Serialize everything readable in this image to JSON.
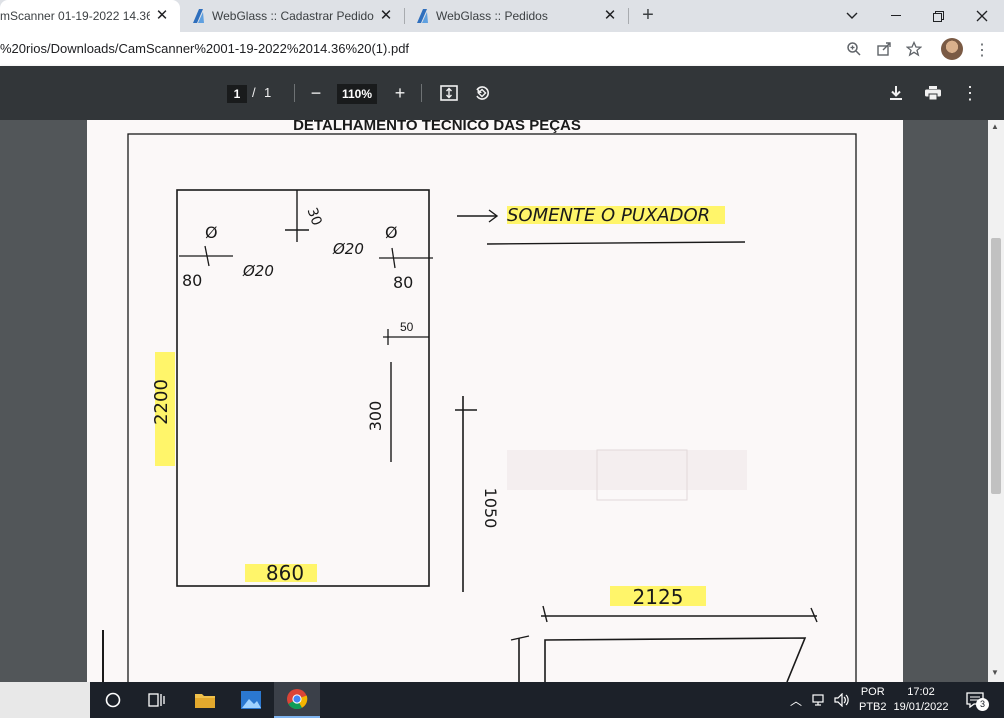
{
  "browser": {
    "tabs": [
      {
        "title": "mScanner 01-19-2022 14.36",
        "active": true
      },
      {
        "title": "WebGlass :: Cadastrar Pedido",
        "active": false
      },
      {
        "title": "WebGlass :: Pedidos",
        "active": false
      }
    ],
    "close_glyph": "✕",
    "new_tab_glyph": "+",
    "url": "%20rios/Downloads/CamScanner%2001-19-2022%2014.36%20(1).pdf"
  },
  "pdf_toolbar": {
    "page_current": "1",
    "page_separator": "/",
    "page_total": "1",
    "zoom": "110%",
    "zoom_out": "−",
    "zoom_in": "+"
  },
  "document": {
    "heading": "DETALHAMENTO TÉCNICO DAS PEÇAS",
    "notes": {
      "only_handle": "SOMENTE O PUXADOR",
      "hole_left": "Ø",
      "hole_right": "Ø",
      "dim_30": "30",
      "dim_80_left": "80",
      "dim_80_right": "80",
      "dia_20_left": "Ø20",
      "dia_20_right": "Ø20",
      "dim_50": "50",
      "dim_300": "300",
      "height_main": "2200",
      "width_main": "860",
      "dim_1050": "1050",
      "width_second": "2125"
    }
  },
  "taskbar": {
    "lang_top": "POR",
    "lang_bottom": "PTB2",
    "time": "17:02",
    "date": "19/01/2022",
    "notif_count": "3"
  }
}
